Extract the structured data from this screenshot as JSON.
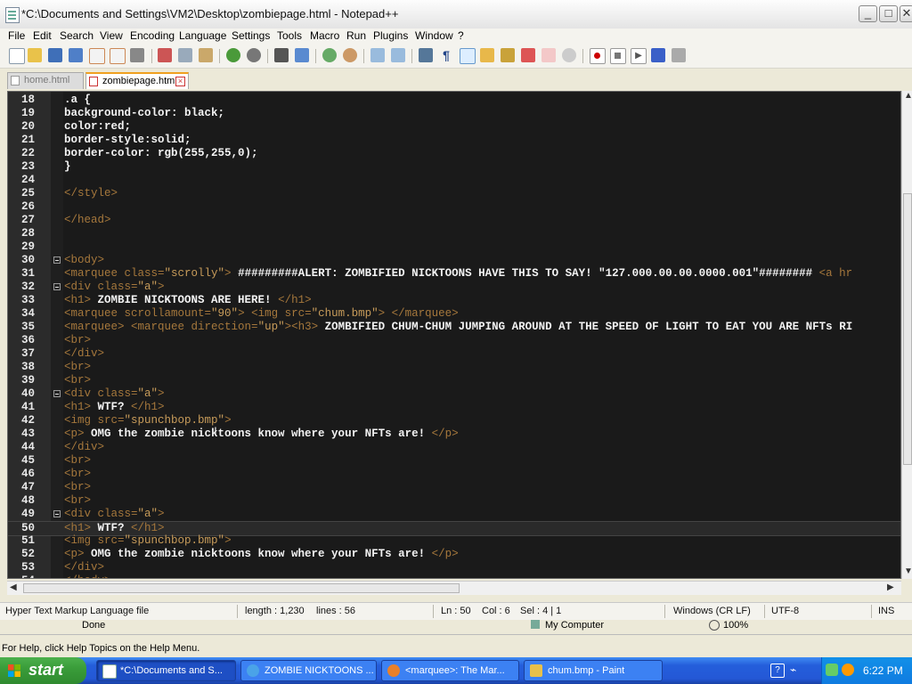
{
  "window": {
    "title": "*C:\\Documents and Settings\\VM2\\Desktop\\zombiepage.html - Notepad++",
    "min": "_",
    "max": "□",
    "close": "✕"
  },
  "menu": [
    "File",
    "Edit",
    "Search",
    "View",
    "Encoding",
    "Language",
    "Settings",
    "Tools",
    "Macro",
    "Run",
    "Plugins",
    "Window",
    "?"
  ],
  "toolbar_icons": [
    "new-file-icon",
    "open-file-icon",
    "save-icon",
    "save-all-icon",
    "close-icon",
    "close-all-icon",
    "print-icon",
    "cut-icon",
    "copy-icon",
    "paste-icon",
    "undo-icon",
    "redo-icon",
    "find-icon",
    "replace-icon",
    "zoom-in-icon",
    "zoom-out-icon",
    "sync-vertical-icon",
    "sync-horizontal-icon",
    "word-wrap-icon",
    "show-all-chars-icon",
    "indent-guide-icon",
    "user-language-icon",
    "doc-map-icon",
    "function-list-icon",
    "folder-as-workspace-icon",
    "monitoring-icon",
    "record-macro-icon",
    "stop-record-icon",
    "play-macro-icon",
    "run-macro-multiple-icon",
    "save-macro-icon"
  ],
  "tabs": [
    {
      "label": "home.html"
    },
    {
      "label": "zombiepage.html"
    }
  ],
  "editor": {
    "lines": [
      {
        "n": "18",
        "fold": false,
        "parts": [
          {
            "c": "css",
            "t": ".a {"
          }
        ]
      },
      {
        "n": "19",
        "fold": false,
        "parts": [
          {
            "c": "css",
            "t": "background-color: black;"
          }
        ]
      },
      {
        "n": "20",
        "fold": false,
        "parts": [
          {
            "c": "css",
            "t": "color:red;"
          }
        ]
      },
      {
        "n": "21",
        "fold": false,
        "parts": [
          {
            "c": "css",
            "t": "border-style:solid;"
          }
        ]
      },
      {
        "n": "22",
        "fold": false,
        "parts": [
          {
            "c": "css",
            "t": "border-color: rgb(255,255,0);"
          }
        ]
      },
      {
        "n": "23",
        "fold": false,
        "parts": [
          {
            "c": "css",
            "t": "}"
          }
        ]
      },
      {
        "n": "24",
        "fold": false,
        "parts": []
      },
      {
        "n": "25",
        "fold": false,
        "parts": [
          {
            "c": "tag",
            "t": "</style>"
          }
        ]
      },
      {
        "n": "26",
        "fold": false,
        "parts": []
      },
      {
        "n": "27",
        "fold": false,
        "parts": [
          {
            "c": "tag",
            "t": "</head>"
          }
        ]
      },
      {
        "n": "28",
        "fold": false,
        "parts": []
      },
      {
        "n": "29",
        "fold": false,
        "parts": []
      },
      {
        "n": "30",
        "fold": true,
        "parts": [
          {
            "c": "tag",
            "t": "<body>"
          }
        ]
      },
      {
        "n": "31",
        "fold": false,
        "parts": [
          {
            "c": "tag",
            "t": "<marquee "
          },
          {
            "c": "attr",
            "t": "class="
          },
          {
            "c": "val",
            "t": "\"scrolly\""
          },
          {
            "c": "tag",
            "t": ">"
          },
          {
            "c": "txt",
            "t": " #########ALERT: ZOMBIFIED NICKTOONS HAVE THIS TO SAY! \"127.000.00.00.0000.001\"######## "
          },
          {
            "c": "tag",
            "t": "<a hr"
          }
        ]
      },
      {
        "n": "32",
        "fold": true,
        "parts": [
          {
            "c": "tag",
            "t": "<div "
          },
          {
            "c": "attr",
            "t": "class="
          },
          {
            "c": "val",
            "t": "\"a\""
          },
          {
            "c": "tag",
            "t": ">"
          }
        ]
      },
      {
        "n": "33",
        "fold": false,
        "parts": [
          {
            "c": "tag",
            "t": "<h1>"
          },
          {
            "c": "txt",
            "t": " ZOMBIE NICKTOONS ARE HERE! "
          },
          {
            "c": "tag",
            "t": "</h1>"
          }
        ]
      },
      {
        "n": "34",
        "fold": false,
        "parts": [
          {
            "c": "tag",
            "t": "<marquee "
          },
          {
            "c": "attr",
            "t": "scrollamount="
          },
          {
            "c": "val",
            "t": "\"90\""
          },
          {
            "c": "tag",
            "t": ">"
          },
          {
            "c": "txt",
            "t": " "
          },
          {
            "c": "tag",
            "t": "<img "
          },
          {
            "c": "attr",
            "t": "src="
          },
          {
            "c": "val",
            "t": "\"chum.bmp\""
          },
          {
            "c": "tag",
            "t": ">"
          },
          {
            "c": "txt",
            "t": " "
          },
          {
            "c": "tag",
            "t": "</marquee>"
          }
        ]
      },
      {
        "n": "35",
        "fold": false,
        "parts": [
          {
            "c": "tag",
            "t": "<marquee>"
          },
          {
            "c": "txt",
            "t": " "
          },
          {
            "c": "tag",
            "t": "<marquee "
          },
          {
            "c": "attr",
            "t": "direction="
          },
          {
            "c": "val",
            "t": "\"up\""
          },
          {
            "c": "tag",
            "t": "><h3>"
          },
          {
            "c": "txt",
            "t": " ZOMBIFIED CHUM-CHUM JUMPING AROUND AT THE SPEED OF LIGHT TO EAT YOU ARE NFTs RI"
          }
        ]
      },
      {
        "n": "36",
        "fold": false,
        "parts": [
          {
            "c": "tag",
            "t": "<br>"
          }
        ]
      },
      {
        "n": "37",
        "fold": false,
        "parts": [
          {
            "c": "tag",
            "t": "</div>"
          }
        ]
      },
      {
        "n": "38",
        "fold": false,
        "parts": [
          {
            "c": "tag",
            "t": "<br>"
          }
        ]
      },
      {
        "n": "39",
        "fold": false,
        "parts": [
          {
            "c": "tag",
            "t": "<br>"
          }
        ]
      },
      {
        "n": "40",
        "fold": true,
        "parts": [
          {
            "c": "tag",
            "t": "<div "
          },
          {
            "c": "attr",
            "t": "class="
          },
          {
            "c": "val",
            "t": "\"a\""
          },
          {
            "c": "tag",
            "t": ">"
          }
        ]
      },
      {
        "n": "41",
        "fold": false,
        "parts": [
          {
            "c": "tag",
            "t": "<h1>"
          },
          {
            "c": "txt",
            "t": " WTF? "
          },
          {
            "c": "tag",
            "t": "</h1>"
          }
        ]
      },
      {
        "n": "42",
        "fold": false,
        "parts": [
          {
            "c": "tag",
            "t": "<img "
          },
          {
            "c": "attr",
            "t": "src="
          },
          {
            "c": "val",
            "t": "\"spunchbop.bmp\""
          },
          {
            "c": "tag",
            "t": ">"
          }
        ]
      },
      {
        "n": "43",
        "fold": false,
        "parts": [
          {
            "c": "tag",
            "t": "<p>"
          },
          {
            "c": "txt",
            "t": " OMG the zombie nicktoons know where your NFTs are! "
          },
          {
            "c": "tag",
            "t": "</p>"
          }
        ]
      },
      {
        "n": "44",
        "fold": false,
        "parts": [
          {
            "c": "tag",
            "t": "</div>"
          }
        ]
      },
      {
        "n": "45",
        "fold": false,
        "parts": [
          {
            "c": "tag",
            "t": "<br>"
          }
        ]
      },
      {
        "n": "46",
        "fold": false,
        "parts": [
          {
            "c": "tag",
            "t": "<br>"
          }
        ]
      },
      {
        "n": "47",
        "fold": false,
        "parts": [
          {
            "c": "tag",
            "t": "<br>"
          }
        ]
      },
      {
        "n": "48",
        "fold": false,
        "parts": [
          {
            "c": "tag",
            "t": "<br>"
          }
        ]
      },
      {
        "n": "49",
        "fold": true,
        "parts": [
          {
            "c": "tag",
            "t": "<div "
          },
          {
            "c": "attr",
            "t": "class="
          },
          {
            "c": "val",
            "t": "\"a\""
          },
          {
            "c": "tag",
            "t": ">"
          }
        ]
      },
      {
        "n": "50",
        "fold": false,
        "current": true,
        "parts": [
          {
            "c": "tag",
            "t": "<h1>"
          },
          {
            "c": "txt",
            "t": " WTF? "
          },
          {
            "c": "tag",
            "t": "</h1>"
          }
        ]
      },
      {
        "n": "51",
        "fold": false,
        "parts": [
          {
            "c": "tag",
            "t": "<img "
          },
          {
            "c": "attr",
            "t": "src="
          },
          {
            "c": "val",
            "t": "\"spunchbop.bmp\""
          },
          {
            "c": "tag",
            "t": ">"
          }
        ]
      },
      {
        "n": "52",
        "fold": false,
        "parts": [
          {
            "c": "tag",
            "t": "<p>"
          },
          {
            "c": "txt",
            "t": " OMG the zombie nicktoons know where your NFTs are! "
          },
          {
            "c": "tag",
            "t": "</p>"
          }
        ]
      },
      {
        "n": "53",
        "fold": false,
        "parts": [
          {
            "c": "tag",
            "t": "</div>"
          }
        ]
      },
      {
        "n": "54",
        "fold": false,
        "parts": [
          {
            "c": "tag",
            "t": "</body>"
          }
        ]
      }
    ]
  },
  "status": {
    "file_type": "Hyper Text Markup Language file",
    "length": "length : 1,230",
    "lines": "lines : 56",
    "ln": "Ln : 50",
    "col": "Col : 6",
    "sel": "Sel : 4 | 1",
    "eol": "Windows (CR LF)",
    "encoding": "UTF-8",
    "mode": "INS"
  },
  "behind": {
    "done": "Done",
    "my_computer": "My Computer",
    "zoom": "100%",
    "help": "For Help, click Help Topics on the Help Menu."
  },
  "taskbar": {
    "start": "start",
    "tasks": [
      {
        "label": "*C:\\Documents and S...",
        "active": true
      },
      {
        "label": "ZOMBIE NICKTOONS ...",
        "active": false
      },
      {
        "label": "<marquee>: The Mar...",
        "active": false
      },
      {
        "label": "chum.bmp - Paint",
        "active": false
      }
    ],
    "clock": "6:22 PM"
  },
  "colors": {
    "editor_bg": "#1a1a1a",
    "tag": "#a6783c",
    "text": "#f2f2f2",
    "taskbar": "#245edb",
    "start": "#3a9d3a"
  }
}
